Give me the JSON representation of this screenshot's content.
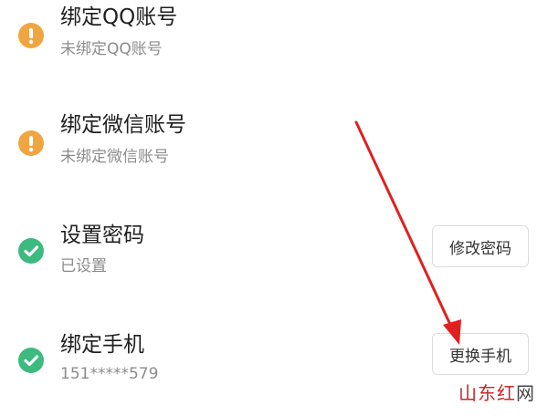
{
  "accounts": [
    {
      "title": "绑定QQ账号",
      "status_text": "未绑定QQ账号",
      "state": "unbound",
      "icon": "warning-icon"
    },
    {
      "title": "绑定微信账号",
      "status_text": "未绑定微信账号",
      "state": "unbound",
      "icon": "warning-icon"
    },
    {
      "title": "设置密码",
      "status_text": "已设置",
      "state": "set",
      "icon": "check-icon",
      "action_label": "修改密码"
    },
    {
      "title": "绑定手机",
      "status_text": "151*****579",
      "state": "set",
      "icon": "check-icon",
      "action_label": "更换手机"
    }
  ],
  "colors": {
    "warning": "#F0A640",
    "success": "#3DBA7E",
    "arrow": "#E02020",
    "watermark": "#C62828"
  },
  "watermark": {
    "main": "山东红",
    "tail": "网"
  }
}
